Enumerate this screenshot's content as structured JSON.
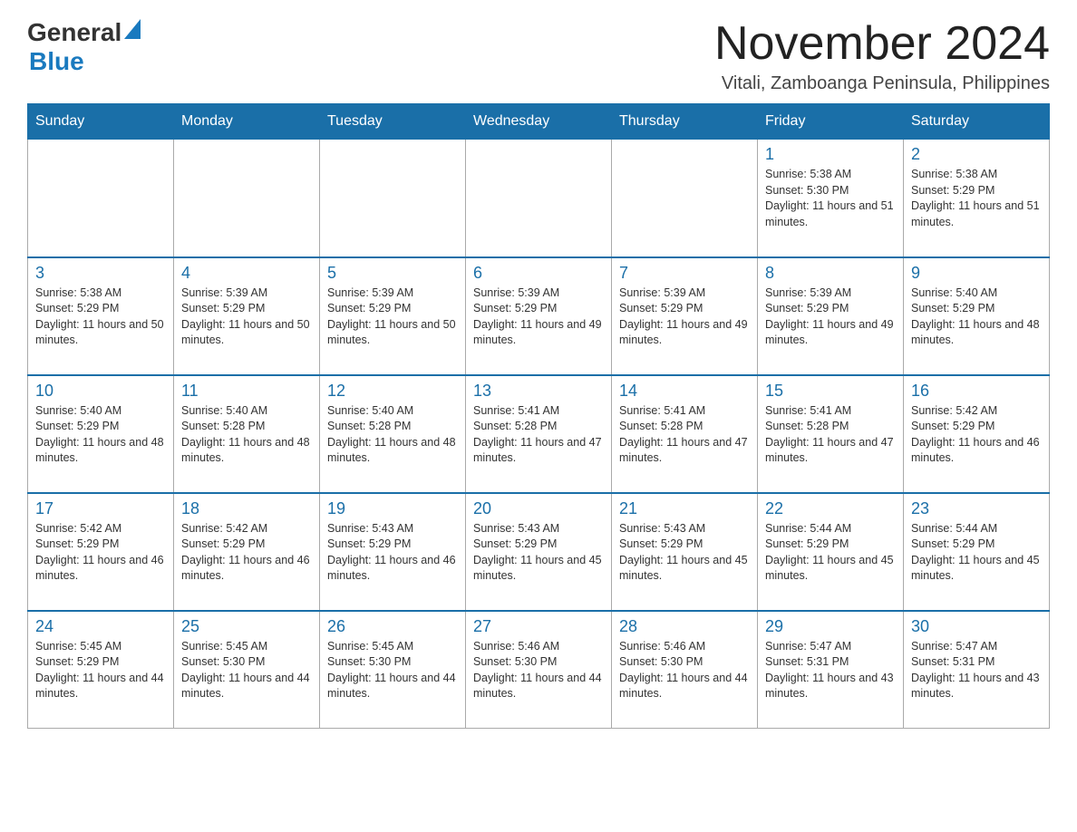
{
  "logo": {
    "general": "General",
    "blue": "Blue"
  },
  "title": "November 2024",
  "location": "Vitali, Zamboanga Peninsula, Philippines",
  "days_of_week": [
    "Sunday",
    "Monday",
    "Tuesday",
    "Wednesday",
    "Thursday",
    "Friday",
    "Saturday"
  ],
  "weeks": [
    [
      {
        "day": "",
        "info": ""
      },
      {
        "day": "",
        "info": ""
      },
      {
        "day": "",
        "info": ""
      },
      {
        "day": "",
        "info": ""
      },
      {
        "day": "",
        "info": ""
      },
      {
        "day": "1",
        "info": "Sunrise: 5:38 AM\nSunset: 5:30 PM\nDaylight: 11 hours and 51 minutes."
      },
      {
        "day": "2",
        "info": "Sunrise: 5:38 AM\nSunset: 5:29 PM\nDaylight: 11 hours and 51 minutes."
      }
    ],
    [
      {
        "day": "3",
        "info": "Sunrise: 5:38 AM\nSunset: 5:29 PM\nDaylight: 11 hours and 50 minutes."
      },
      {
        "day": "4",
        "info": "Sunrise: 5:39 AM\nSunset: 5:29 PM\nDaylight: 11 hours and 50 minutes."
      },
      {
        "day": "5",
        "info": "Sunrise: 5:39 AM\nSunset: 5:29 PM\nDaylight: 11 hours and 50 minutes."
      },
      {
        "day": "6",
        "info": "Sunrise: 5:39 AM\nSunset: 5:29 PM\nDaylight: 11 hours and 49 minutes."
      },
      {
        "day": "7",
        "info": "Sunrise: 5:39 AM\nSunset: 5:29 PM\nDaylight: 11 hours and 49 minutes."
      },
      {
        "day": "8",
        "info": "Sunrise: 5:39 AM\nSunset: 5:29 PM\nDaylight: 11 hours and 49 minutes."
      },
      {
        "day": "9",
        "info": "Sunrise: 5:40 AM\nSunset: 5:29 PM\nDaylight: 11 hours and 48 minutes."
      }
    ],
    [
      {
        "day": "10",
        "info": "Sunrise: 5:40 AM\nSunset: 5:29 PM\nDaylight: 11 hours and 48 minutes."
      },
      {
        "day": "11",
        "info": "Sunrise: 5:40 AM\nSunset: 5:28 PM\nDaylight: 11 hours and 48 minutes."
      },
      {
        "day": "12",
        "info": "Sunrise: 5:40 AM\nSunset: 5:28 PM\nDaylight: 11 hours and 48 minutes."
      },
      {
        "day": "13",
        "info": "Sunrise: 5:41 AM\nSunset: 5:28 PM\nDaylight: 11 hours and 47 minutes."
      },
      {
        "day": "14",
        "info": "Sunrise: 5:41 AM\nSunset: 5:28 PM\nDaylight: 11 hours and 47 minutes."
      },
      {
        "day": "15",
        "info": "Sunrise: 5:41 AM\nSunset: 5:28 PM\nDaylight: 11 hours and 47 minutes."
      },
      {
        "day": "16",
        "info": "Sunrise: 5:42 AM\nSunset: 5:29 PM\nDaylight: 11 hours and 46 minutes."
      }
    ],
    [
      {
        "day": "17",
        "info": "Sunrise: 5:42 AM\nSunset: 5:29 PM\nDaylight: 11 hours and 46 minutes."
      },
      {
        "day": "18",
        "info": "Sunrise: 5:42 AM\nSunset: 5:29 PM\nDaylight: 11 hours and 46 minutes."
      },
      {
        "day": "19",
        "info": "Sunrise: 5:43 AM\nSunset: 5:29 PM\nDaylight: 11 hours and 46 minutes."
      },
      {
        "day": "20",
        "info": "Sunrise: 5:43 AM\nSunset: 5:29 PM\nDaylight: 11 hours and 45 minutes."
      },
      {
        "day": "21",
        "info": "Sunrise: 5:43 AM\nSunset: 5:29 PM\nDaylight: 11 hours and 45 minutes."
      },
      {
        "day": "22",
        "info": "Sunrise: 5:44 AM\nSunset: 5:29 PM\nDaylight: 11 hours and 45 minutes."
      },
      {
        "day": "23",
        "info": "Sunrise: 5:44 AM\nSunset: 5:29 PM\nDaylight: 11 hours and 45 minutes."
      }
    ],
    [
      {
        "day": "24",
        "info": "Sunrise: 5:45 AM\nSunset: 5:29 PM\nDaylight: 11 hours and 44 minutes."
      },
      {
        "day": "25",
        "info": "Sunrise: 5:45 AM\nSunset: 5:30 PM\nDaylight: 11 hours and 44 minutes."
      },
      {
        "day": "26",
        "info": "Sunrise: 5:45 AM\nSunset: 5:30 PM\nDaylight: 11 hours and 44 minutes."
      },
      {
        "day": "27",
        "info": "Sunrise: 5:46 AM\nSunset: 5:30 PM\nDaylight: 11 hours and 44 minutes."
      },
      {
        "day": "28",
        "info": "Sunrise: 5:46 AM\nSunset: 5:30 PM\nDaylight: 11 hours and 44 minutes."
      },
      {
        "day": "29",
        "info": "Sunrise: 5:47 AM\nSunset: 5:31 PM\nDaylight: 11 hours and 43 minutes."
      },
      {
        "day": "30",
        "info": "Sunrise: 5:47 AM\nSunset: 5:31 PM\nDaylight: 11 hours and 43 minutes."
      }
    ]
  ]
}
